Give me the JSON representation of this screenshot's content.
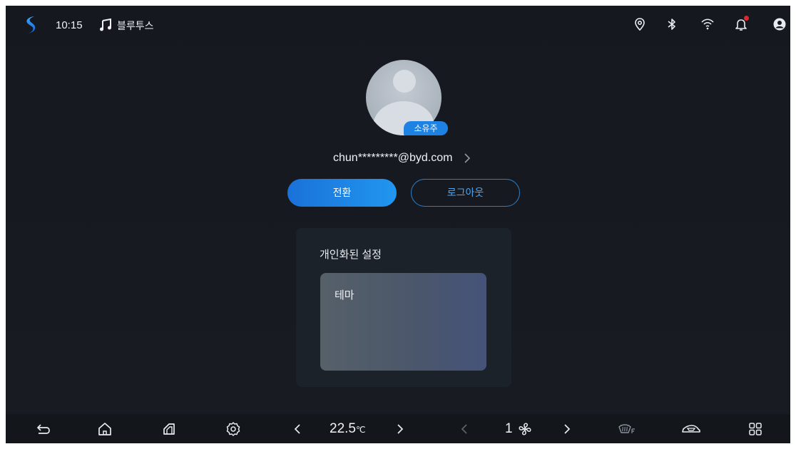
{
  "statusbar": {
    "time": "10:15",
    "bluetooth_label": "블루투스",
    "icons": [
      "app-logo-icon",
      "music-note-icon",
      "location-icon",
      "bluetooth-icon",
      "wifi-icon",
      "notification-bell-icon",
      "user-account-icon"
    ]
  },
  "profile": {
    "badge": "소유주",
    "email": "chun*********@byd.com",
    "switch_label": "전환",
    "logout_label": "로그아웃"
  },
  "settings": {
    "title": "개인화된 설정",
    "theme_label": "테마"
  },
  "bottombar": {
    "temperature_value": "22.5",
    "temperature_unit": "℃",
    "fan_speed": "1",
    "icons": [
      "back-icon",
      "home-icon",
      "window-icon",
      "settings-gear-icon",
      "chevron-left-icon",
      "chevron-right-icon",
      "fan-icon",
      "front-defrost-icon",
      "car-icon",
      "apps-grid-icon"
    ]
  },
  "colors": {
    "accent": "#1e82e3",
    "background": "#161a20",
    "card": "#1c2229",
    "notification_dot": "#e0262d"
  }
}
